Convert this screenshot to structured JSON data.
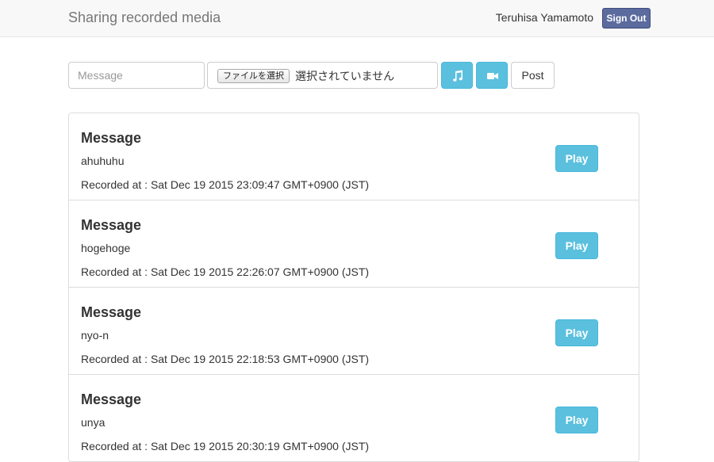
{
  "header": {
    "title": "Sharing recorded media",
    "user_name": "Teruhisa Yamamoto",
    "signout_label": "Sign Out"
  },
  "form": {
    "message_placeholder": "Message",
    "file_button_label": "ファイルを選択",
    "file_status": "選択されていません",
    "audio_icon": "music-note-icon",
    "video_icon": "video-camera-icon",
    "post_label": "Post"
  },
  "items": [
    {
      "heading": "Message",
      "text": "ahuhuhu",
      "recorded": "Recorded at : Sat Dec 19 2015 23:09:47 GMT+0900 (JST)",
      "play_label": "Play"
    },
    {
      "heading": "Message",
      "text": "hogehoge",
      "recorded": "Recorded at : Sat Dec 19 2015 22:26:07 GMT+0900 (JST)",
      "play_label": "Play"
    },
    {
      "heading": "Message",
      "text": "nyo-n",
      "recorded": "Recorded at : Sat Dec 19 2015 22:18:53 GMT+0900 (JST)",
      "play_label": "Play"
    },
    {
      "heading": "Message",
      "text": "unya",
      "recorded": "Recorded at : Sat Dec 19 2015 20:30:19 GMT+0900 (JST)",
      "play_label": "Play"
    }
  ],
  "colors": {
    "info_button": "#5bc0de",
    "signout_button": "#5c6b9e",
    "navbar_bg": "#f8f8f8"
  }
}
